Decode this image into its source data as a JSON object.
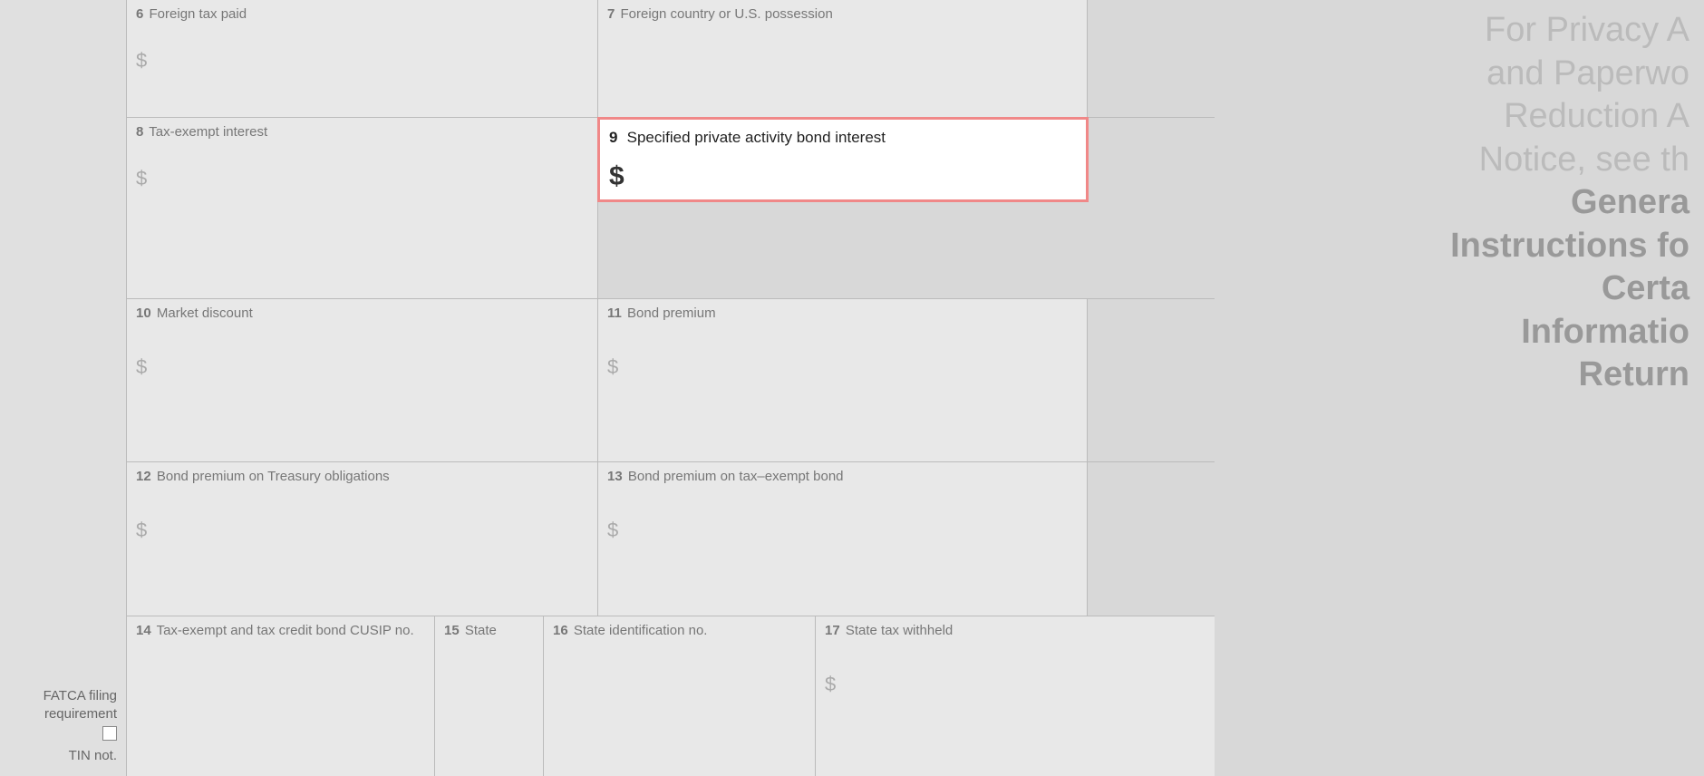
{
  "form": {
    "fields": {
      "f6": {
        "number": "6",
        "label": "Foreign tax paid",
        "dollar": "$"
      },
      "f7": {
        "number": "7",
        "label": "Foreign country or U.S. possession"
      },
      "f8": {
        "number": "8",
        "label": "Tax-exempt interest",
        "dollar": "$"
      },
      "f9": {
        "number": "9",
        "label": "Specified private activity bond interest",
        "dollar": "$"
      },
      "f10": {
        "number": "10",
        "label": "Market discount",
        "dollar": "$"
      },
      "f11": {
        "number": "11",
        "label": "Bond premium",
        "dollar": "$"
      },
      "f12": {
        "number": "12",
        "label": "Bond premium on Treasury obligations",
        "dollar": "$"
      },
      "f13": {
        "number": "13",
        "label": "Bond premium on tax–exempt bond",
        "dollar": "$"
      },
      "f14": {
        "number": "14",
        "label": "Tax-exempt and tax credit bond CUSIP no."
      },
      "f15": {
        "number": "15",
        "label": "State"
      },
      "f16": {
        "number": "16",
        "label": "State identification no."
      },
      "f17": {
        "number": "17",
        "label": "State tax withheld",
        "dollar": "$"
      }
    },
    "left_labels": {
      "fatca": "FATCA filing requirement",
      "tin": "TIN not."
    }
  },
  "instructions": {
    "line1": "For Privacy A",
    "line2": "and Paperwo",
    "line3": "Reduction A",
    "line4": "Notice, see th",
    "line5": "Genera",
    "line6": "Instructions fo",
    "line7": "Certa",
    "line8": "Informatio",
    "line9": "Return"
  }
}
